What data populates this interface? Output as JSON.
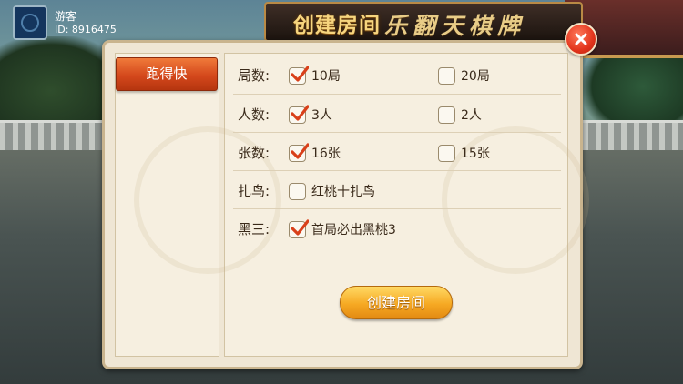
{
  "user": {
    "name": "游客",
    "id": "ID: 8916475"
  },
  "banner": {
    "title": "创建房间",
    "brand": "乐翻天棋牌"
  },
  "sidebar": {
    "tabs": [
      {
        "label": "跑得快",
        "active": true
      }
    ]
  },
  "rules": [
    {
      "label": "局数:",
      "options": [
        {
          "text": "10局",
          "checked": true
        },
        {
          "text": "20局",
          "checked": false
        }
      ]
    },
    {
      "label": "人数:",
      "options": [
        {
          "text": "3人",
          "checked": true
        },
        {
          "text": "2人",
          "checked": false
        }
      ]
    },
    {
      "label": "张数:",
      "options": [
        {
          "text": "16张",
          "checked": true
        },
        {
          "text": "15张",
          "checked": false
        }
      ]
    },
    {
      "label": "扎鸟:",
      "options": [
        {
          "text": "红桃十扎鸟",
          "checked": false
        }
      ]
    },
    {
      "label": "黑三:",
      "options": [
        {
          "text": "首局必出黑桃3",
          "checked": true
        }
      ]
    }
  ],
  "actions": {
    "create_label": "创建房间"
  },
  "colors": {
    "accent_tab": "#d4481c",
    "create_button": "#f6a923",
    "close_button": "#e2341c",
    "check_mark": "#d9401a",
    "panel_bg": "#f6efe0"
  }
}
